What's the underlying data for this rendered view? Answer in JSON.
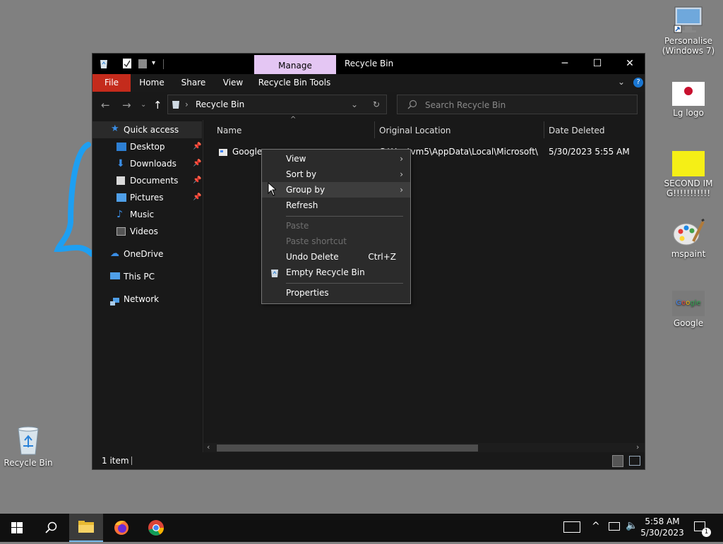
{
  "desktop": {
    "icons": [
      {
        "label": "Personalise (Windows 7)"
      },
      {
        "label": "Lg logo"
      },
      {
        "label": "SECOND IMG!!!!!!!!!!!"
      },
      {
        "label": "mspaint"
      },
      {
        "label": "Google"
      },
      {
        "label": "Recycle Bin"
      }
    ]
  },
  "window": {
    "title": "Recycle Bin",
    "manage_tab": "Manage",
    "ribbon_tabs": [
      "File",
      "Home",
      "Share",
      "View",
      "Recycle Bin Tools"
    ],
    "address": "Recycle Bin",
    "search_placeholder": "Search Recycle Bin",
    "sidebar": [
      {
        "label": "Quick access",
        "icon": "star-icon"
      },
      {
        "label": "Desktop",
        "icon": "desktop-folder-icon",
        "pinned": true
      },
      {
        "label": "Downloads",
        "icon": "download-arrow-icon",
        "pinned": true
      },
      {
        "label": "Documents",
        "icon": "documents-icon",
        "pinned": true
      },
      {
        "label": "Pictures",
        "icon": "pictures-icon",
        "pinned": true
      },
      {
        "label": "Music",
        "icon": "music-note-icon"
      },
      {
        "label": "Videos",
        "icon": "videos-icon"
      },
      {
        "label": "OneDrive",
        "icon": "cloud-icon"
      },
      {
        "label": "This PC",
        "icon": "pc-monitor-icon"
      },
      {
        "label": "Network",
        "icon": "network-icon"
      }
    ],
    "columns": [
      "Name",
      "Original Location",
      "Date Deleted"
    ],
    "file": {
      "name": "Google",
      "location": "C:\\U... \\vm5\\AppData\\Local\\Microsoft\\...",
      "date_deleted": "5/30/2023 5:55 AM"
    },
    "status": "1 item"
  },
  "context_menu": {
    "items": [
      {
        "label": "View",
        "submenu": true,
        "enabled": true
      },
      {
        "label": "Sort by",
        "submenu": true,
        "enabled": true
      },
      {
        "label": "Group by",
        "submenu": true,
        "enabled": true
      },
      {
        "label": "Refresh",
        "enabled": true
      },
      {
        "label": "Paste",
        "enabled": false
      },
      {
        "label": "Paste shortcut",
        "enabled": false
      },
      {
        "label": "Undo Delete",
        "shortcut": "Ctrl+Z",
        "enabled": true
      },
      {
        "label": "Empty Recycle Bin",
        "enabled": true
      },
      {
        "label": "Properties",
        "enabled": true
      }
    ]
  },
  "taskbar": {
    "time": "5:58 AM",
    "date": "5/30/2023",
    "notification_count": "1"
  },
  "colors": {
    "accent_file_tab": "#c42b1c",
    "manage_tab": "#e4c6f3",
    "desktop_bg": "#808080",
    "window_bg": "#191919"
  }
}
